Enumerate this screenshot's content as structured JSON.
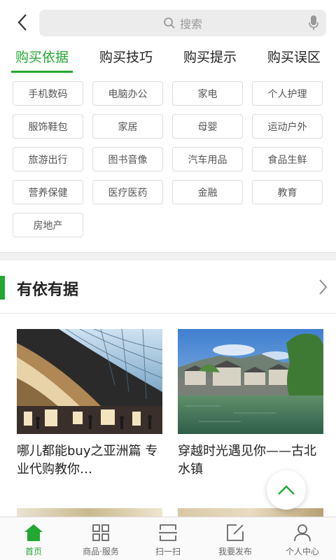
{
  "search": {
    "placeholder": "搜索"
  },
  "tabs": [
    {
      "label": "购买依据",
      "active": true
    },
    {
      "label": "购买技巧",
      "active": false
    },
    {
      "label": "购买提示",
      "active": false
    },
    {
      "label": "购买误区",
      "active": false
    }
  ],
  "categories": [
    "手机数码",
    "电脑办公",
    "家电",
    "个人护理",
    "服饰鞋包",
    "家居",
    "母婴",
    "运动户外",
    "旅游出行",
    "图书音像",
    "汽车用品",
    "食品生鲜",
    "营养保健",
    "医疗医药",
    "金融",
    "教育",
    "房地产"
  ],
  "section": {
    "title": "有依有据"
  },
  "articles": [
    {
      "title": "哪儿都能buy之亚洲篇  专业代购教你…"
    },
    {
      "title": "穿越时光遇见你——古北水镇"
    }
  ],
  "bottom_nav": [
    {
      "label": "首页",
      "icon": "home-icon",
      "active": true
    },
    {
      "label": "商品·服务",
      "icon": "grid-icon",
      "active": false
    },
    {
      "label": "扫一扫",
      "icon": "scan-icon",
      "active": false
    },
    {
      "label": "我要发布",
      "icon": "edit-icon",
      "active": false
    },
    {
      "label": "个人中心",
      "icon": "user-icon",
      "active": false
    }
  ],
  "colors": {
    "accent": "#23a832",
    "border": "#dcdcdc",
    "search_bg": "#ececec"
  }
}
